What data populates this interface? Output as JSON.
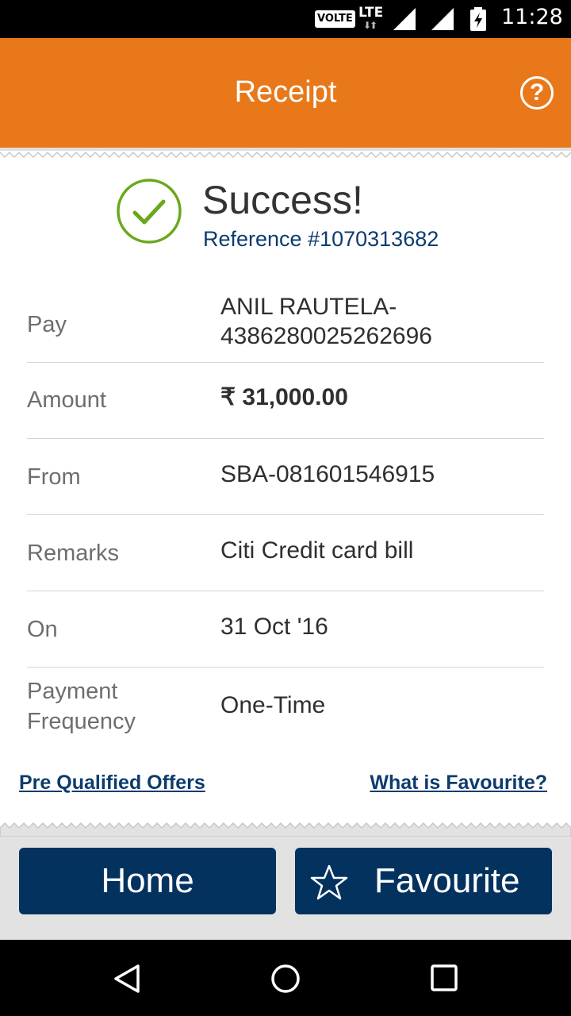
{
  "status_bar": {
    "volte": "VOLTE",
    "network": "LTE",
    "time": "11:28"
  },
  "header": {
    "title": "Receipt",
    "help_icon": "help-icon"
  },
  "result": {
    "status": "Success!",
    "reference": "Reference #1070313682",
    "accent_color": "#6aa81c"
  },
  "details": [
    {
      "label": "Pay",
      "value": "ANIL RAUTELA-\n4386280025262696"
    },
    {
      "label": "Amount",
      "value": "₹ 31,000.00"
    },
    {
      "label": "From",
      "value": "SBA-081601546915"
    },
    {
      "label": "Remarks",
      "value": "Citi Credit card bill"
    },
    {
      "label": "On",
      "value": "31 Oct '16"
    },
    {
      "label": "Payment\nFrequency",
      "value": "One-Time"
    }
  ],
  "links": {
    "pre_qualified": "Pre Qualified Offers",
    "what_is_favourite": "What is Favourite?"
  },
  "buttons": {
    "home": "Home",
    "favourite": "Favourite"
  },
  "nav": [
    "back-icon",
    "home-circle-icon",
    "recents-square-icon"
  ],
  "colors": {
    "brand_orange": "#e8781a",
    "button_navy": "#04325f",
    "link_blue": "#0c3c6e"
  }
}
